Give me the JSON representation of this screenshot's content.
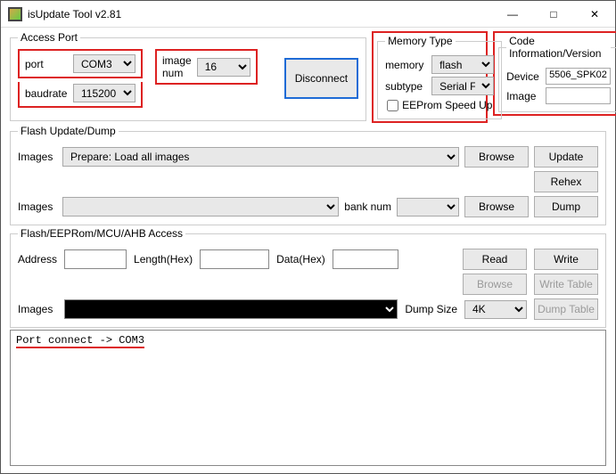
{
  "window": {
    "title": "isUpdate Tool v2.81",
    "minimize_glyph": "—",
    "maximize_glyph": "□",
    "close_glyph": "✕"
  },
  "access_port": {
    "legend": "Access Port",
    "port_label": "port",
    "port_value": "COM3",
    "baud_label": "baudrate",
    "baud_value": "115200",
    "imgnum_label": "image num",
    "imgnum_value": "16",
    "disconnect": "Disconnect"
  },
  "memory_type": {
    "legend": "Memory Type",
    "memory_label": "memory",
    "memory_value": "flash",
    "subtype_label": "subtype",
    "subtype_value": "Serial Flash",
    "eep_label": "EEProm Speed Up"
  },
  "code_info": {
    "legend": "Code Information/Version",
    "device_label": "Device",
    "device_value": "5506_SPK02",
    "image_label": "Image",
    "image_value": ""
  },
  "flash_update": {
    "legend": "Flash Update/Dump",
    "images_label": "Images",
    "images_value": "Prepare: Load all images",
    "browse": "Browse",
    "update": "Update",
    "rehex": "Rehex",
    "banknum_label": "bank num",
    "dump": "Dump"
  },
  "access": {
    "legend": "Flash/EEPRom/MCU/AHB Access",
    "address_label": "Address",
    "length_label": "Length(Hex)",
    "data_label": "Data(Hex)",
    "read": "Read",
    "write": "Write",
    "browse": "Browse",
    "write_table": "Write Table",
    "images_label": "Images",
    "dumpsize_label": "Dump Size",
    "dumpsize_value": "4K",
    "dump_table": "Dump Table"
  },
  "log": {
    "line1": "Port connect -> COM3"
  }
}
